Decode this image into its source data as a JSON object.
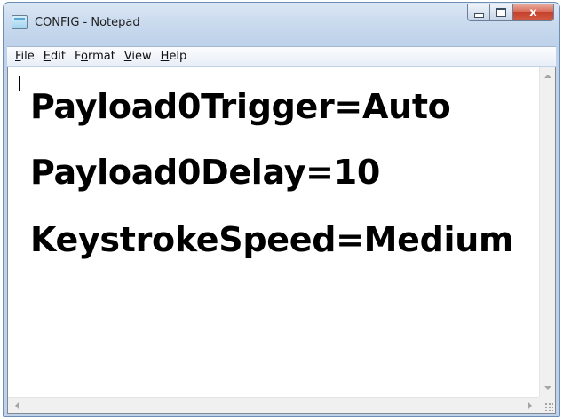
{
  "window": {
    "title": "CONFIG - Notepad",
    "close_glyph": "x"
  },
  "menubar": {
    "items": [
      {
        "accel": "F",
        "rest": "ile"
      },
      {
        "accel": "E",
        "rest": "dit"
      },
      {
        "pre": "F",
        "accel": "o",
        "rest": "rmat"
      },
      {
        "accel": "V",
        "rest": "iew"
      },
      {
        "accel": "H",
        "rest": "elp"
      }
    ]
  },
  "document": {
    "lines": [
      "Payload0Trigger=Auto",
      "Payload0Delay=10",
      "KeystrokeSpeed=Medium"
    ]
  },
  "icons": {
    "app": "notepad-icon",
    "minimize": "minimize-icon",
    "maximize": "maximize-icon",
    "close": "close-icon"
  },
  "colors": {
    "close_button": "#c5412c",
    "frame": "#bed2ea",
    "text": "#000000"
  }
}
